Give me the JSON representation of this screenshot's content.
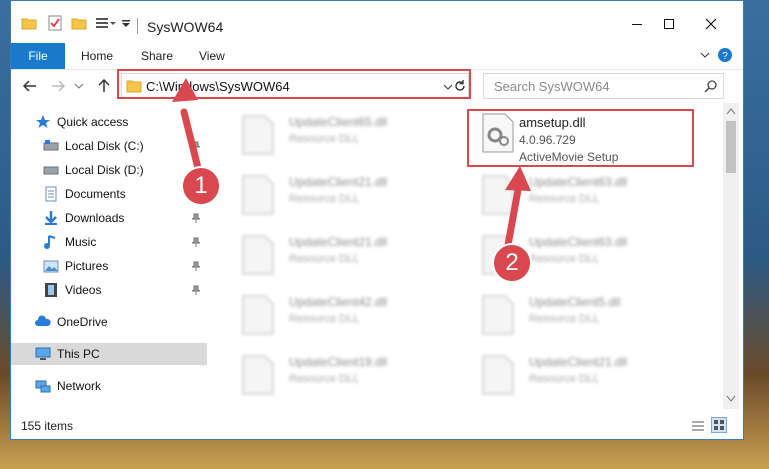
{
  "window": {
    "title": "SysWOW64"
  },
  "ribbon": {
    "tabs": [
      "File",
      "Home",
      "Share",
      "View"
    ]
  },
  "nav": {
    "address": "C:\\Windows\\SysWOW64",
    "search_placeholder": "Search SysWOW64"
  },
  "sidebar": {
    "quick_access": "Quick access",
    "items": [
      "Local Disk (C:)",
      "Local Disk (D:)",
      "Documents",
      "Downloads",
      "Music",
      "Pictures",
      "Videos"
    ],
    "onedrive": "OneDrive",
    "thispc": "This PC",
    "network": "Network"
  },
  "files": {
    "left": [
      {
        "name": "UpdateClient65.dll",
        "desc": "Resource DLL"
      },
      {
        "name": "UpdateClient21.dll",
        "desc": "Resource DLL"
      },
      {
        "name": "UpdateClient21.dll",
        "desc": "Resource DLL"
      },
      {
        "name": "UpdateClient42.dll",
        "desc": "Resource DLL"
      },
      {
        "name": "UpdateClient19.dll",
        "desc": "Resource DLL"
      }
    ],
    "highlighted": {
      "name": "amsetup.dll",
      "version": "4.0.96.729",
      "desc": "ActiveMovie Setup"
    },
    "right": [
      {
        "name": "UpdateClient63.dll",
        "desc": "Resource DLL"
      },
      {
        "name": "UpdateClient63.dll",
        "desc": "Resource DLL"
      },
      {
        "name": "UpdateClient5.dll",
        "desc": "Resource DLL"
      },
      {
        "name": "UpdateClient21.dll",
        "desc": "Resource DLL"
      }
    ]
  },
  "status": {
    "count": "155 items"
  },
  "annotations": {
    "step1": "1",
    "step2": "2"
  },
  "colors": {
    "accent": "#1979ca",
    "highlight": "#d9474f"
  }
}
